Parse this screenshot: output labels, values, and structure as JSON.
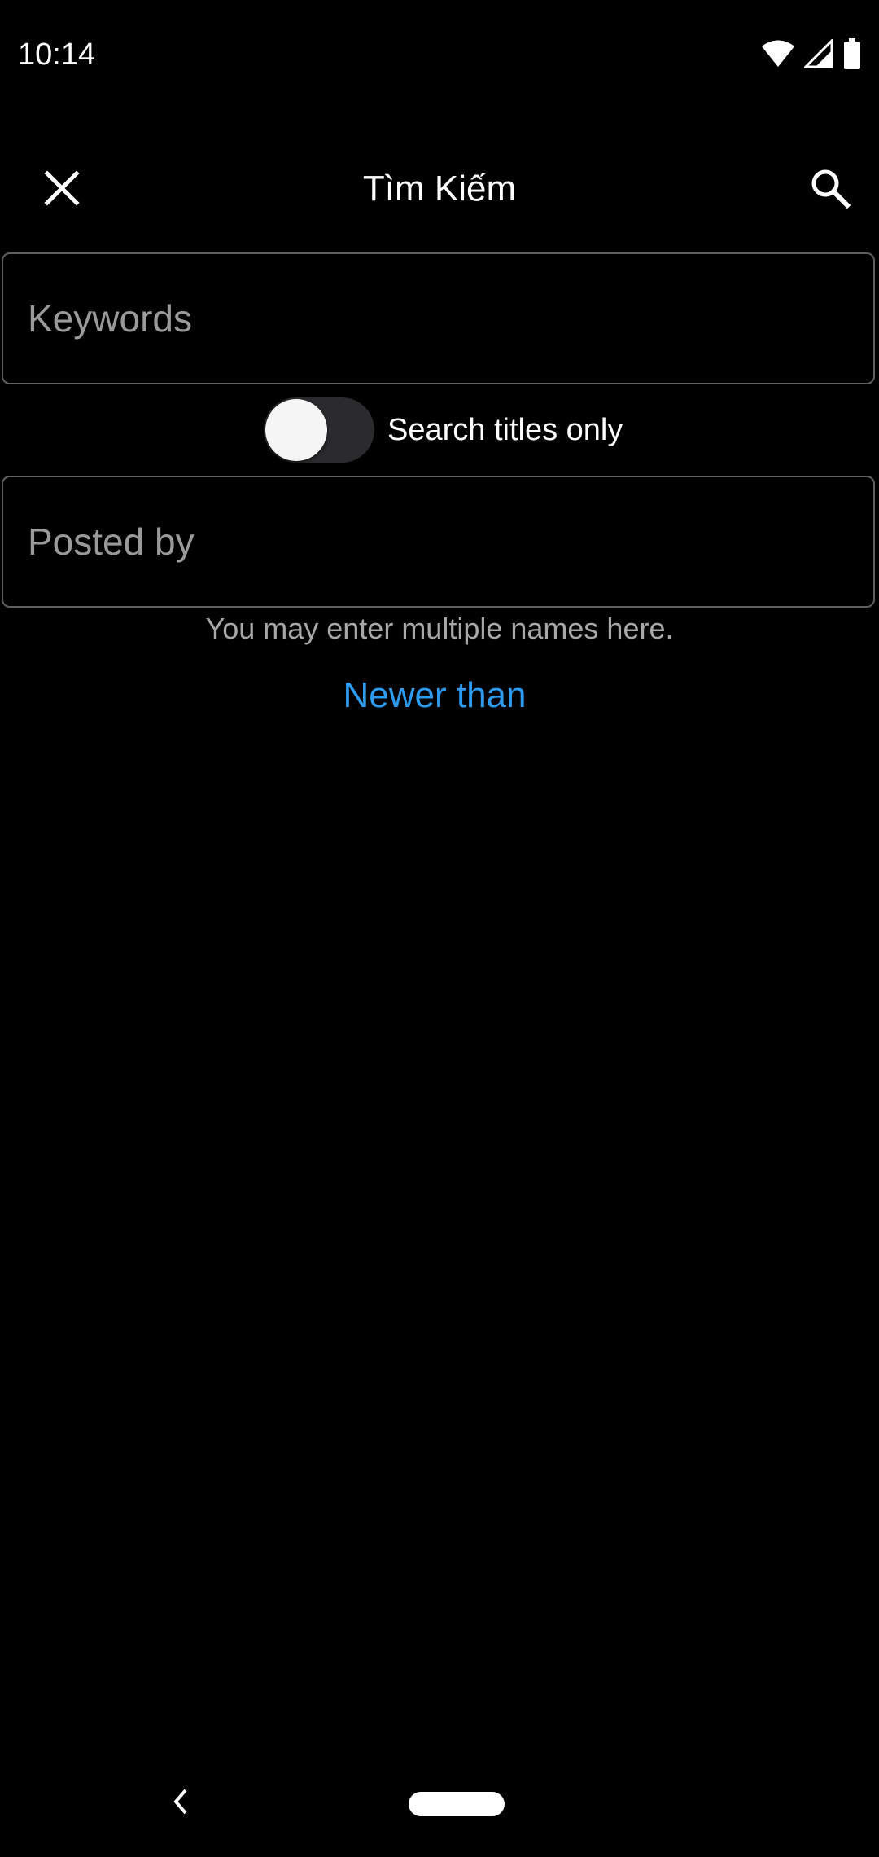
{
  "status_bar": {
    "time": "10:14",
    "icons": [
      "wifi-icon",
      "signal-icon",
      "battery-icon"
    ]
  },
  "toolbar": {
    "title": "Tìm Kiếm",
    "close_icon": "close-icon",
    "search_icon": "search-icon"
  },
  "form": {
    "keywords": {
      "placeholder": "Keywords",
      "value": ""
    },
    "search_titles_only": {
      "label": "Search titles only",
      "checked": false
    },
    "posted_by": {
      "placeholder": "Posted by",
      "value": ""
    },
    "helper_text": "You may enter multiple names here.",
    "newer_than_label": "Newer than"
  },
  "nav_bar": {
    "back_icon": "back-chevron-icon",
    "home_icon": "home-pill-icon"
  },
  "colors": {
    "background": "#000000",
    "accent": "#2d9cf0",
    "field_border": "#5f5f5f",
    "placeholder": "#9a9a9a",
    "helper": "#a8a8a8"
  }
}
